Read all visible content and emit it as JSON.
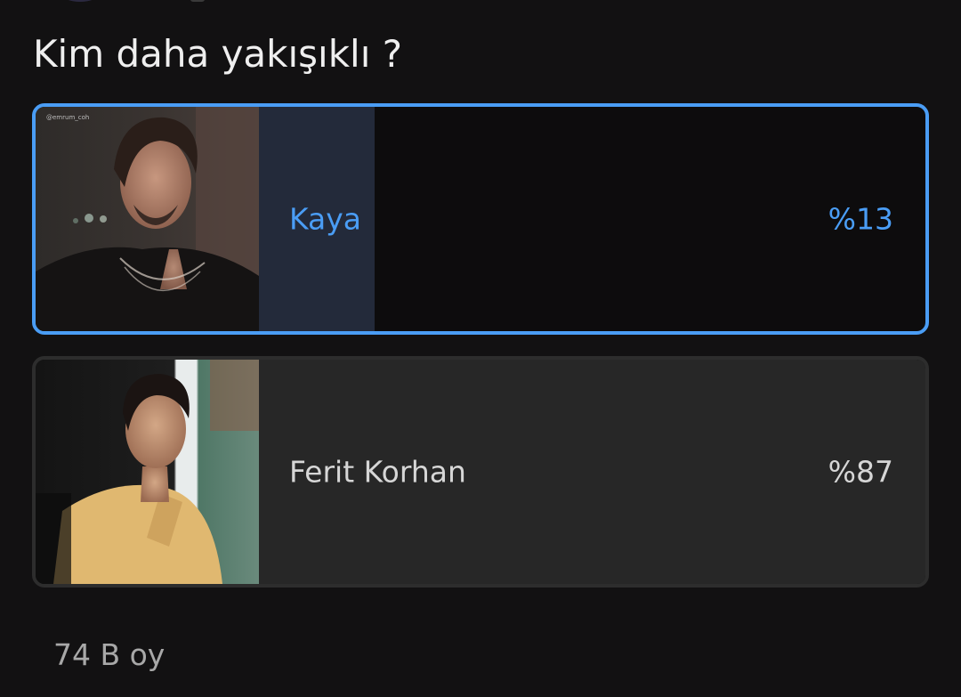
{
  "poll": {
    "question": "Kim daha yakışıklı ?",
    "options": [
      {
        "label": "Kaya",
        "percent_text": "%13",
        "share": 0.13,
        "selected": true,
        "photo_caption": "@emrum_coh"
      },
      {
        "label": "Ferit Korhan",
        "percent_text": "%87",
        "share": 0.87,
        "selected": false
      }
    ],
    "vote_count": "74 B oy"
  },
  "colors": {
    "background": "#121112",
    "accent": "#4a9df5",
    "selected_fill": "#232a3a",
    "unselected_fill": "#272727",
    "unselected_border": "#2d2d2d"
  }
}
